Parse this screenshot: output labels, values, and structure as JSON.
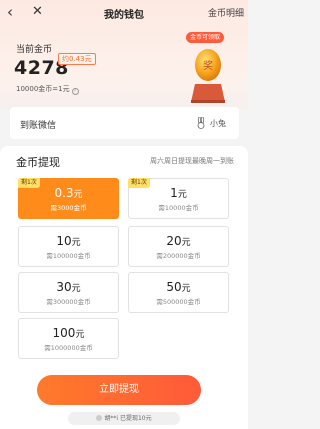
{
  "navbar": {
    "title": "我的钱包",
    "detail_link": "金币明细"
  },
  "balance": {
    "label": "当前金币",
    "coins": "4278",
    "approx": "约0.43元",
    "rate": "10000金币=1元"
  },
  "promo": {
    "egg_badge": "金币可领取",
    "egg_char": "奖"
  },
  "account": {
    "label": "到账微信",
    "user_name": "小兔"
  },
  "withdraw": {
    "title": "金币提现",
    "note": "周六周日提现最晚周一到账",
    "options": [
      {
        "amount": "0.3",
        "unit": "元",
        "need": "需3000金币",
        "tag": "剩1次",
        "selected": true
      },
      {
        "amount": "1",
        "unit": "元",
        "need": "需10000金币",
        "tag": "剩1次",
        "selected": false
      },
      {
        "amount": "10",
        "unit": "元",
        "need": "需100000金币",
        "tag": "",
        "selected": false
      },
      {
        "amount": "20",
        "unit": "元",
        "need": "需200000金币",
        "tag": "",
        "selected": false
      },
      {
        "amount": "30",
        "unit": "元",
        "need": "需300000金币",
        "tag": "",
        "selected": false
      },
      {
        "amount": "50",
        "unit": "元",
        "need": "需500000金币",
        "tag": "",
        "selected": false
      },
      {
        "amount": "100",
        "unit": "元",
        "need": "需1000000金币",
        "tag": "",
        "selected": false
      }
    ],
    "button_label": "立即提现",
    "ticker": "胡**i 已提现10元"
  },
  "colors": {
    "accent": "#ff8c1a",
    "button": "#ff5a3a"
  }
}
